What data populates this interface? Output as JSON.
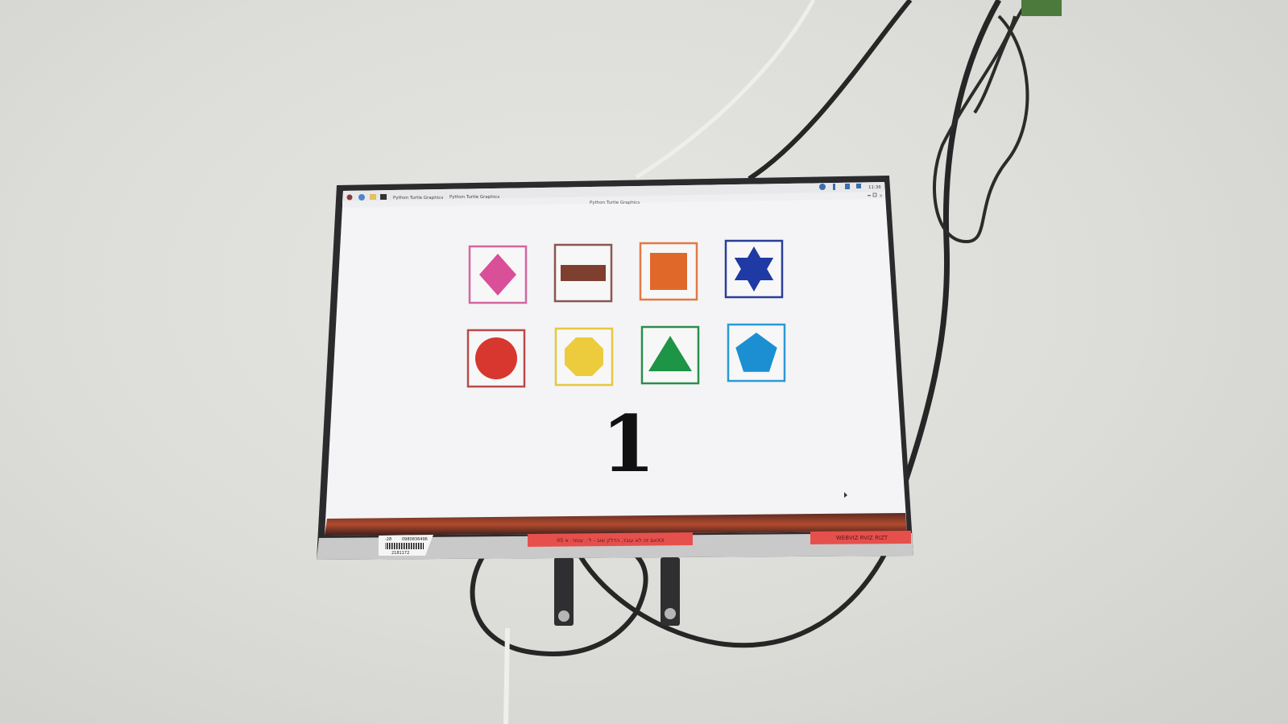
{
  "taskbar": {
    "window_tab_1": "Python Turtle Graphics",
    "window_tab_2": "Python Turtle Graphics",
    "clock": "11:36"
  },
  "window": {
    "title": "Python Turtle Graphics"
  },
  "content": {
    "shapes": [
      {
        "name": "diamond",
        "color": "#d94f98",
        "frame": "#d2679f"
      },
      {
        "name": "rectangle",
        "color": "#7e3f2e",
        "frame": "#8a5650"
      },
      {
        "name": "square",
        "color": "#e0692a",
        "frame": "#e07a45"
      },
      {
        "name": "star",
        "color": "#1f3aa4",
        "frame": "#2a3f96"
      },
      {
        "name": "circle",
        "color": "#d8372f",
        "frame": "#b94a48"
      },
      {
        "name": "octagon",
        "color": "#eccb3c",
        "frame": "#e6c83e"
      },
      {
        "name": "triangle",
        "color": "#1d9446",
        "frame": "#2a8f4c"
      },
      {
        "name": "pentagon",
        "color": "#1b8fd2",
        "frame": "#2b9ad3"
      }
    ],
    "number": "1"
  },
  "labels": {
    "asset_tag_small": "-28",
    "asset_tag_id": "0980836496",
    "asset_tag_serial": "2181172",
    "warning_sticker": "אם זה לא עובד, הדלק שוב - ל׳. עומר. א 05XX",
    "name_sticker": "WEBVIZ RVIZ RIZT"
  },
  "colors": {
    "wall": "#dcdcd8",
    "bezel": "#2b2b2e",
    "screen": "#f4f4f6",
    "sticker_red": "#e5504d"
  }
}
